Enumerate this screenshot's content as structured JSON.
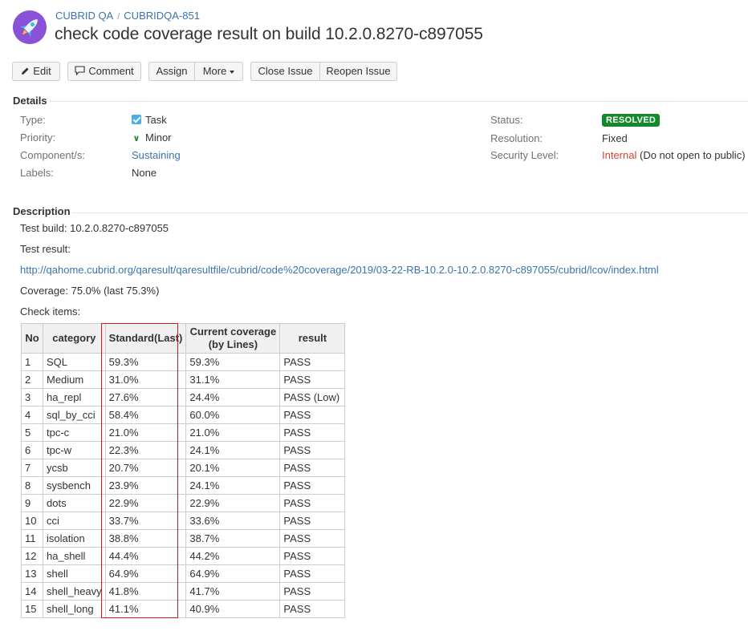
{
  "breadcrumbs": {
    "project": "CUBRID QA",
    "separator": "/",
    "issue_key": "CUBRIDQA-851"
  },
  "issue": {
    "title": "check code coverage result on build 10.2.0.8270-c897055"
  },
  "toolbar": {
    "edit": "Edit",
    "comment": "Comment",
    "assign": "Assign",
    "more": "More",
    "close_issue": "Close Issue",
    "reopen_issue": "Reopen Issue"
  },
  "details": {
    "heading": "Details",
    "type_label": "Type:",
    "type_value": "Task",
    "priority_label": "Priority:",
    "priority_value": "Minor",
    "components_label": "Component/s:",
    "components_value": "Sustaining",
    "labels_label": "Labels:",
    "labels_value": "None",
    "status_label": "Status:",
    "status_value": "RESOLVED",
    "resolution_label": "Resolution:",
    "resolution_value": "Fixed",
    "security_label": "Security Level:",
    "security_value": "Internal",
    "security_note": "(Do not open to public)"
  },
  "description": {
    "heading": "Description",
    "test_build": "Test build: 10.2.0.8270-c897055",
    "test_result": "Test result:",
    "result_url": "http://qahome.cubrid.org/qaresult/qaresultfile/cubrid/code%20coverage/2019/03-22-RB-10.2.0-10.2.0.8270-c897055/cubrid/lcov/index.html",
    "coverage": "Coverage: 75.0% (last 75.3%)",
    "check_items": "Check items:"
  },
  "table": {
    "headers": [
      "No",
      "category",
      "Standard(Last)",
      "Current coverage",
      "(by Lines)",
      "result"
    ],
    "rows": [
      [
        "1",
        "SQL",
        "59.3%",
        "59.3%",
        "PASS"
      ],
      [
        "2",
        "Medium",
        "31.0%",
        "31.1%",
        "PASS"
      ],
      [
        "3",
        "ha_repl",
        "27.6%",
        "24.4%",
        "PASS (Low)"
      ],
      [
        "4",
        "sql_by_cci",
        "58.4%",
        "60.0%",
        "PASS"
      ],
      [
        "5",
        "tpc-c",
        "21.0%",
        "21.0%",
        "PASS"
      ],
      [
        "6",
        "tpc-w",
        "22.3%",
        "24.1%",
        "PASS"
      ],
      [
        "7",
        "ycsb",
        "20.7%",
        "20.1%",
        "PASS"
      ],
      [
        "8",
        "sysbench",
        "23.9%",
        "24.1%",
        "PASS"
      ],
      [
        "9",
        "dots",
        "22.9%",
        "22.9%",
        "PASS"
      ],
      [
        "10",
        "cci",
        "33.7%",
        "33.6%",
        "PASS"
      ],
      [
        "11",
        "isolation",
        "38.8%",
        "38.7%",
        "PASS"
      ],
      [
        "12",
        "ha_shell",
        "44.4%",
        "44.2%",
        "PASS"
      ],
      [
        "13",
        "shell",
        "64.9%",
        "64.9%",
        "PASS"
      ],
      [
        "14",
        "shell_heavy",
        "41.8%",
        "41.7%",
        "PASS"
      ],
      [
        "15",
        "shell_long",
        "41.1%",
        "40.9%",
        "PASS"
      ]
    ]
  },
  "colors": {
    "link": "#3b73af",
    "resolved": "#14892c",
    "highlight": "#d31b1b",
    "avatar": "#8a52d9"
  },
  "icons": [
    "rocket-icon",
    "pencil-icon",
    "comment-icon",
    "task-icon",
    "priority-minor-icon",
    "caret-down-icon"
  ]
}
